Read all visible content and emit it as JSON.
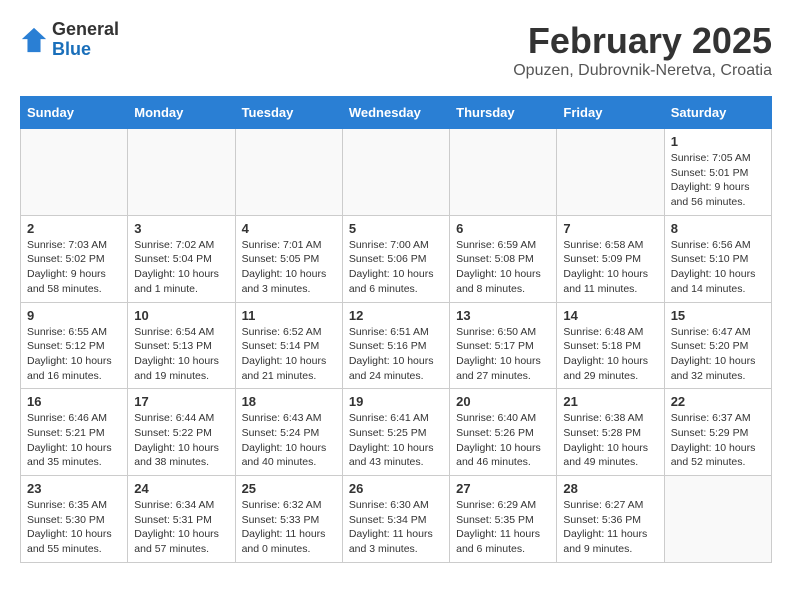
{
  "header": {
    "logo_general": "General",
    "logo_blue": "Blue",
    "month_title": "February 2025",
    "subtitle": "Opuzen, Dubrovnik-Neretva, Croatia"
  },
  "days_of_week": [
    "Sunday",
    "Monday",
    "Tuesday",
    "Wednesday",
    "Thursday",
    "Friday",
    "Saturday"
  ],
  "weeks": [
    [
      {
        "day": "",
        "info": ""
      },
      {
        "day": "",
        "info": ""
      },
      {
        "day": "",
        "info": ""
      },
      {
        "day": "",
        "info": ""
      },
      {
        "day": "",
        "info": ""
      },
      {
        "day": "",
        "info": ""
      },
      {
        "day": "1",
        "info": "Sunrise: 7:05 AM\nSunset: 5:01 PM\nDaylight: 9 hours\nand 56 minutes."
      }
    ],
    [
      {
        "day": "2",
        "info": "Sunrise: 7:03 AM\nSunset: 5:02 PM\nDaylight: 9 hours\nand 58 minutes."
      },
      {
        "day": "3",
        "info": "Sunrise: 7:02 AM\nSunset: 5:04 PM\nDaylight: 10 hours\nand 1 minute."
      },
      {
        "day": "4",
        "info": "Sunrise: 7:01 AM\nSunset: 5:05 PM\nDaylight: 10 hours\nand 3 minutes."
      },
      {
        "day": "5",
        "info": "Sunrise: 7:00 AM\nSunset: 5:06 PM\nDaylight: 10 hours\nand 6 minutes."
      },
      {
        "day": "6",
        "info": "Sunrise: 6:59 AM\nSunset: 5:08 PM\nDaylight: 10 hours\nand 8 minutes."
      },
      {
        "day": "7",
        "info": "Sunrise: 6:58 AM\nSunset: 5:09 PM\nDaylight: 10 hours\nand 11 minutes."
      },
      {
        "day": "8",
        "info": "Sunrise: 6:56 AM\nSunset: 5:10 PM\nDaylight: 10 hours\nand 14 minutes."
      }
    ],
    [
      {
        "day": "9",
        "info": "Sunrise: 6:55 AM\nSunset: 5:12 PM\nDaylight: 10 hours\nand 16 minutes."
      },
      {
        "day": "10",
        "info": "Sunrise: 6:54 AM\nSunset: 5:13 PM\nDaylight: 10 hours\nand 19 minutes."
      },
      {
        "day": "11",
        "info": "Sunrise: 6:52 AM\nSunset: 5:14 PM\nDaylight: 10 hours\nand 21 minutes."
      },
      {
        "day": "12",
        "info": "Sunrise: 6:51 AM\nSunset: 5:16 PM\nDaylight: 10 hours\nand 24 minutes."
      },
      {
        "day": "13",
        "info": "Sunrise: 6:50 AM\nSunset: 5:17 PM\nDaylight: 10 hours\nand 27 minutes."
      },
      {
        "day": "14",
        "info": "Sunrise: 6:48 AM\nSunset: 5:18 PM\nDaylight: 10 hours\nand 29 minutes."
      },
      {
        "day": "15",
        "info": "Sunrise: 6:47 AM\nSunset: 5:20 PM\nDaylight: 10 hours\nand 32 minutes."
      }
    ],
    [
      {
        "day": "16",
        "info": "Sunrise: 6:46 AM\nSunset: 5:21 PM\nDaylight: 10 hours\nand 35 minutes."
      },
      {
        "day": "17",
        "info": "Sunrise: 6:44 AM\nSunset: 5:22 PM\nDaylight: 10 hours\nand 38 minutes."
      },
      {
        "day": "18",
        "info": "Sunrise: 6:43 AM\nSunset: 5:24 PM\nDaylight: 10 hours\nand 40 minutes."
      },
      {
        "day": "19",
        "info": "Sunrise: 6:41 AM\nSunset: 5:25 PM\nDaylight: 10 hours\nand 43 minutes."
      },
      {
        "day": "20",
        "info": "Sunrise: 6:40 AM\nSunset: 5:26 PM\nDaylight: 10 hours\nand 46 minutes."
      },
      {
        "day": "21",
        "info": "Sunrise: 6:38 AM\nSunset: 5:28 PM\nDaylight: 10 hours\nand 49 minutes."
      },
      {
        "day": "22",
        "info": "Sunrise: 6:37 AM\nSunset: 5:29 PM\nDaylight: 10 hours\nand 52 minutes."
      }
    ],
    [
      {
        "day": "23",
        "info": "Sunrise: 6:35 AM\nSunset: 5:30 PM\nDaylight: 10 hours\nand 55 minutes."
      },
      {
        "day": "24",
        "info": "Sunrise: 6:34 AM\nSunset: 5:31 PM\nDaylight: 10 hours\nand 57 minutes."
      },
      {
        "day": "25",
        "info": "Sunrise: 6:32 AM\nSunset: 5:33 PM\nDaylight: 11 hours\nand 0 minutes."
      },
      {
        "day": "26",
        "info": "Sunrise: 6:30 AM\nSunset: 5:34 PM\nDaylight: 11 hours\nand 3 minutes."
      },
      {
        "day": "27",
        "info": "Sunrise: 6:29 AM\nSunset: 5:35 PM\nDaylight: 11 hours\nand 6 minutes."
      },
      {
        "day": "28",
        "info": "Sunrise: 6:27 AM\nSunset: 5:36 PM\nDaylight: 11 hours\nand 9 minutes."
      },
      {
        "day": "",
        "info": ""
      }
    ]
  ]
}
